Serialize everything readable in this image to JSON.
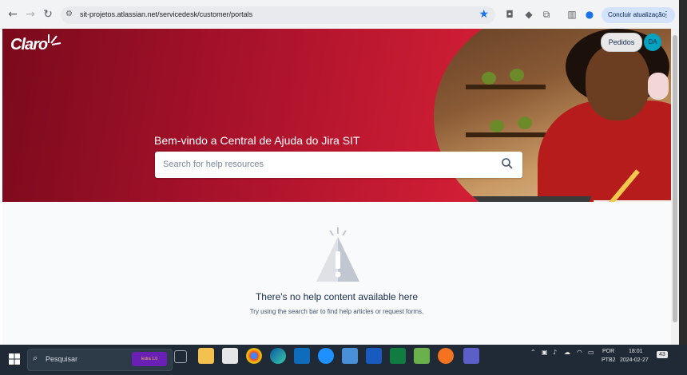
{
  "browser": {
    "url": "sit-projetos.atlassian.net/servicedesk/customer/portals",
    "update_button": "Concluir atualização"
  },
  "header": {
    "logo": "Claro",
    "pedidos_button": "Pedidos",
    "avatar_initials": "DA",
    "welcome_title": "Bem-vindo a Central de Ajuda do Jira SIT",
    "search_placeholder": "Search for help resources"
  },
  "empty_state": {
    "title": "There's no help content available here",
    "subtitle": "Try using the search bar to find help articles or request forms."
  },
  "taskbar": {
    "search_label": "Pesquisar",
    "promo_text": "Extra 1.0",
    "language_top": "POR",
    "language_bottom": "PTB2",
    "time": "18:01",
    "date": "2024-02-27",
    "notification_count": "43"
  },
  "colors": {
    "brand_red": "#c8102e",
    "accent_blue": "#1a73e8",
    "avatar": "#00a3bf"
  }
}
